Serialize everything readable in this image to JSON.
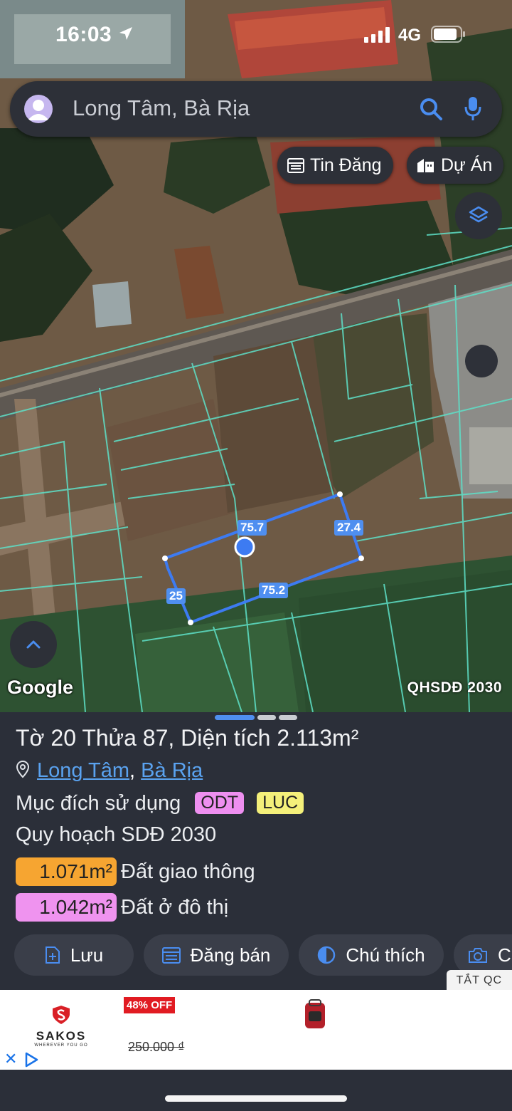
{
  "status_bar": {
    "time": "16:03",
    "network": "4G"
  },
  "search": {
    "placeholder": "Long Tâm, Bà Rịa"
  },
  "chips": {
    "listings": "Tin Đăng",
    "projects": "Dự Án"
  },
  "map": {
    "provider_logo": "Google",
    "layer_label": "QHSDĐ 2030",
    "measurements": {
      "top": "75.7",
      "right": "27.4",
      "bottom": "75.2",
      "left": "25"
    }
  },
  "parcel": {
    "title": "Tờ 20 Thửa 87, Diện tích 2.113m²",
    "location": {
      "ward": "Long Tâm",
      "separator": ", ",
      "city": "Bà Rịa"
    },
    "usage_label": "Mục đích sử dụng",
    "usage_tags": [
      {
        "code": "ODT",
        "color": "#ee8ff0"
      },
      {
        "code": "LUC",
        "color": "#f4f07a"
      }
    ],
    "planning_label": "Quy hoạch SDĐ 2030",
    "planning": [
      {
        "area": "1.071m²",
        "label": "Đất giao thông",
        "color": "#f6a531"
      },
      {
        "area": "1.042m²",
        "label": "Đất ở đô thị",
        "color": "#ef93ef"
      }
    ]
  },
  "actions": {
    "save": "Lưu",
    "sell": "Đăng bán",
    "legend": "Chú thích",
    "camera": "C"
  },
  "ad": {
    "hide_label": "TẮT QC",
    "brand": "SAKOS",
    "tagline": "WHEREVER YOU GO",
    "discount": "48% OFF",
    "old_price": "250.000 ₫"
  },
  "colors": {
    "accent": "#4f8ff0",
    "panel_bg": "#2b2f39",
    "link": "#5aa2ef"
  }
}
